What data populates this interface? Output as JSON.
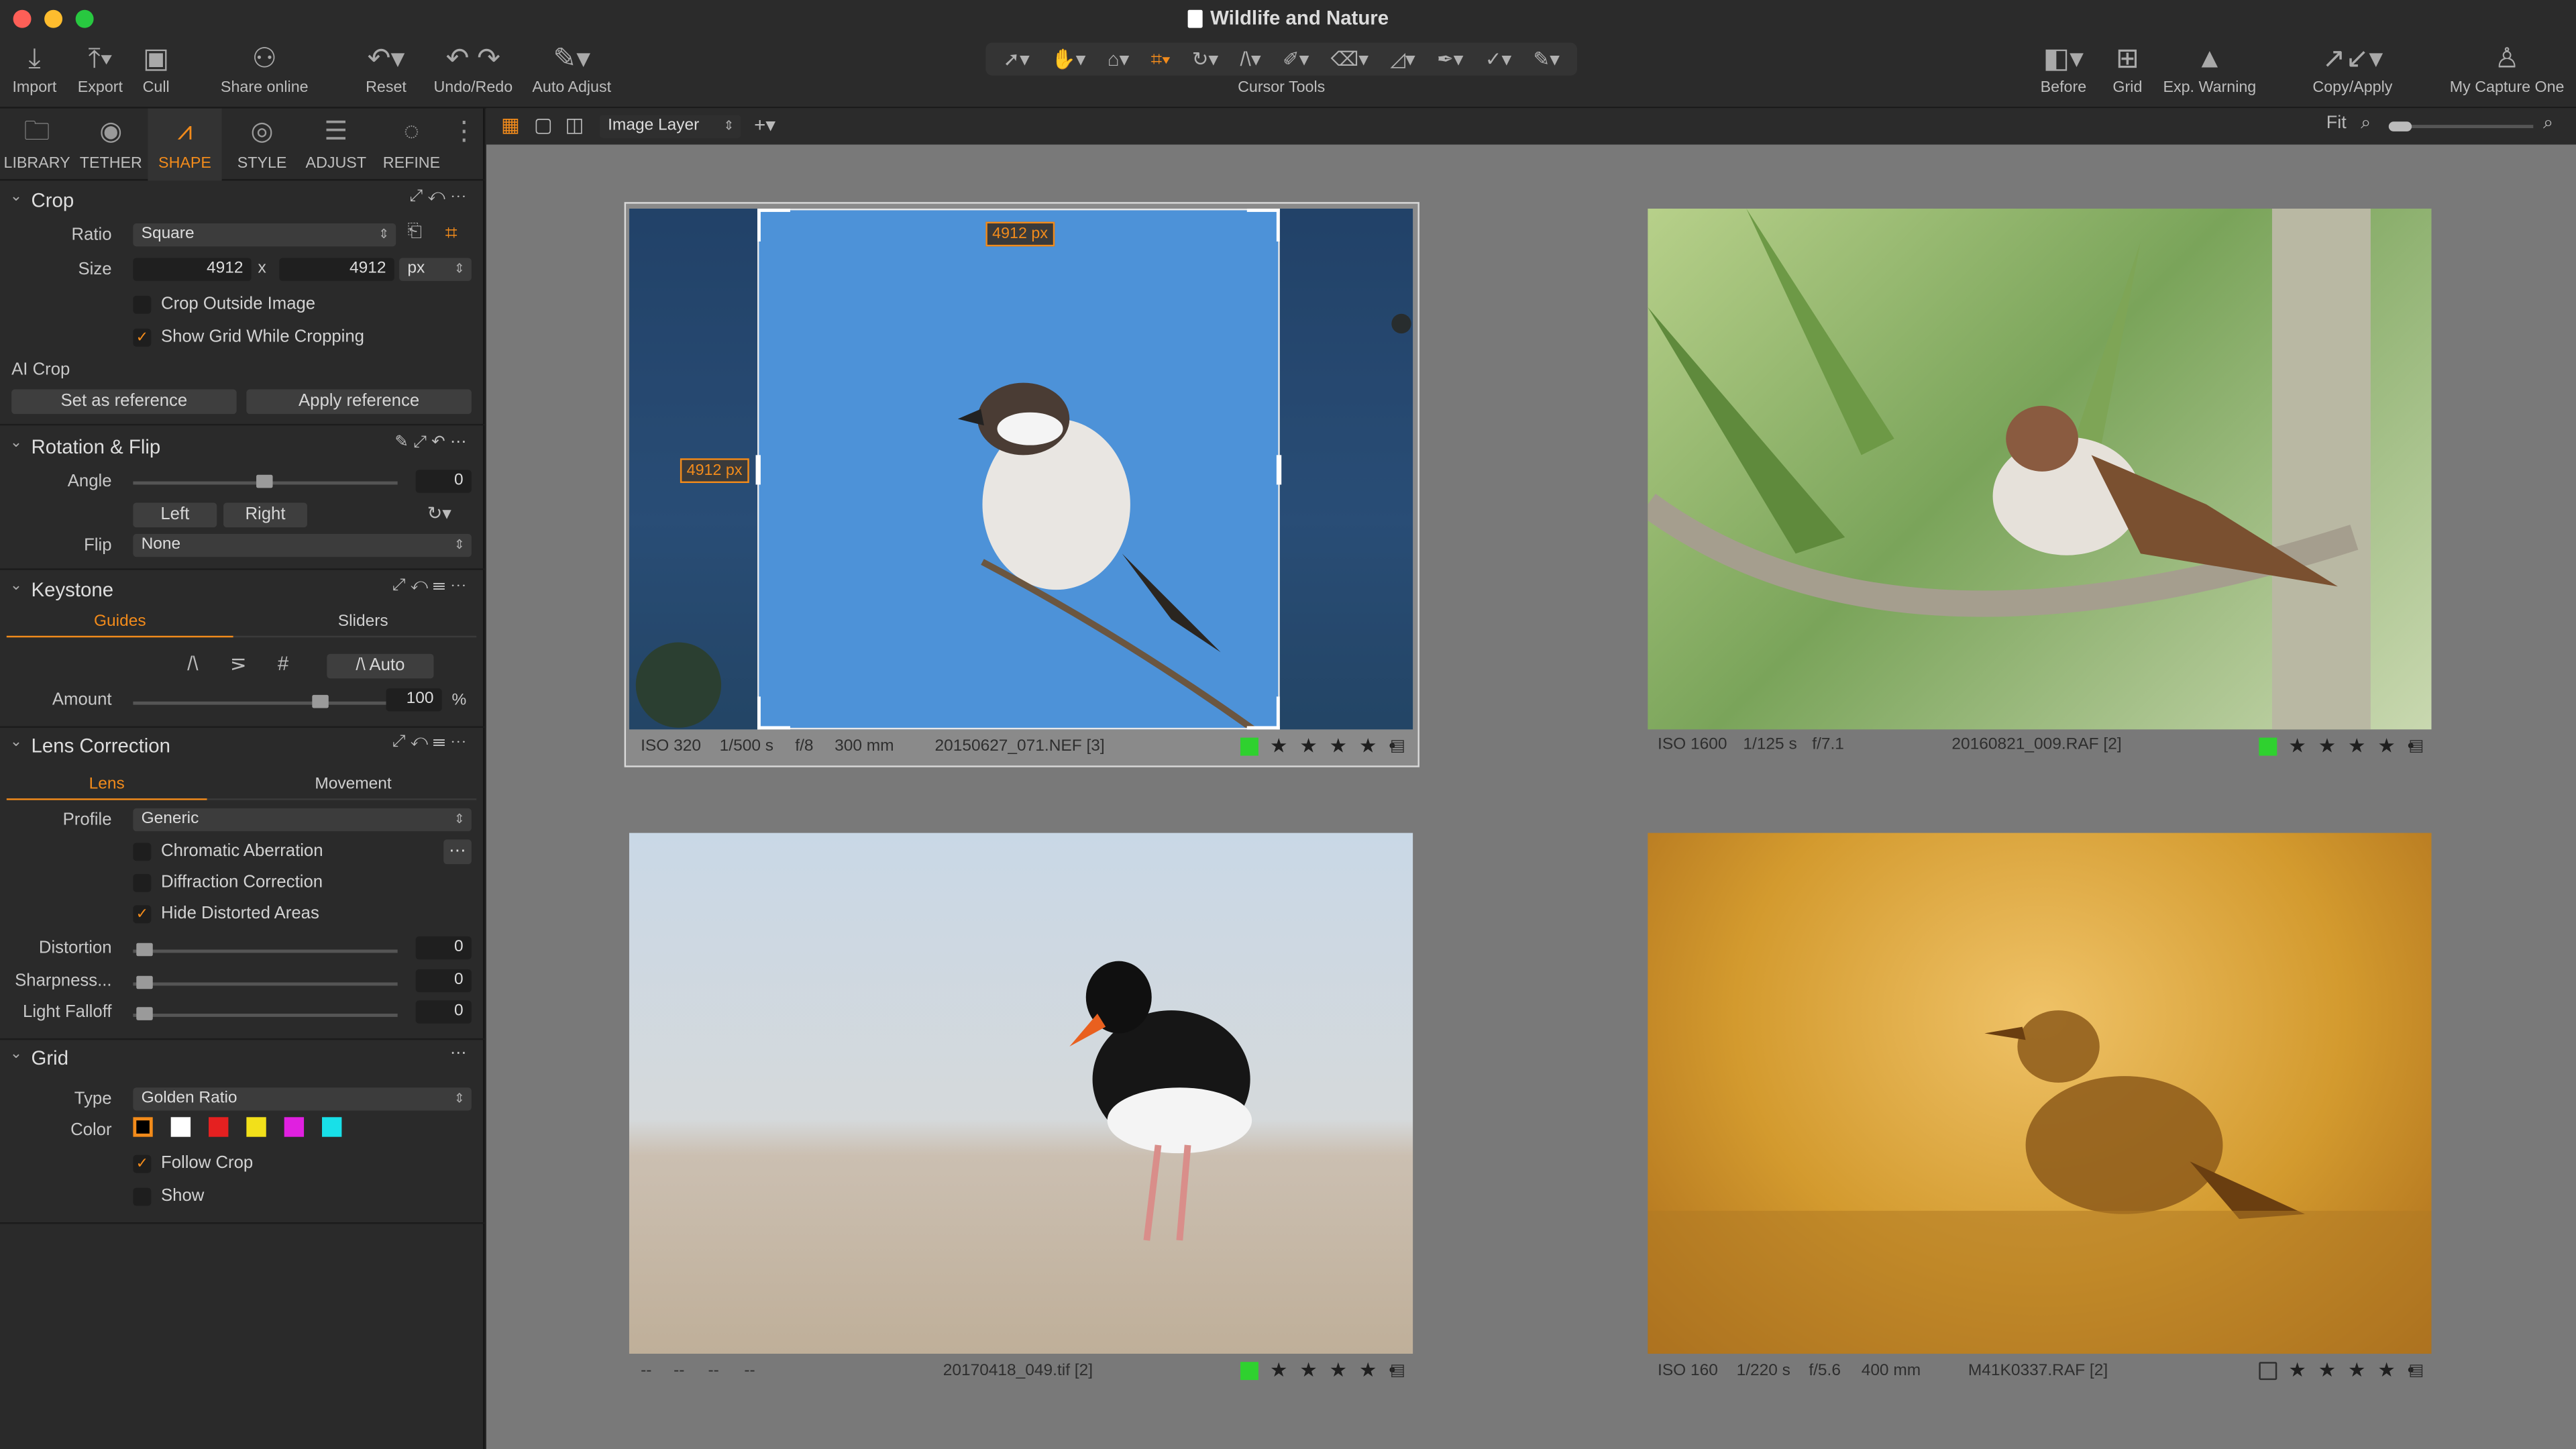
{
  "app": {
    "title": "Wildlife and Nature"
  },
  "toolbar": {
    "left": [
      {
        "label": "Import",
        "icon": "import-icon"
      },
      {
        "label": "Export",
        "icon": "export-icon"
      },
      {
        "label": "Cull",
        "icon": "cull-icon"
      },
      {
        "label": "Share online",
        "icon": "share-icon"
      },
      {
        "label": "Reset",
        "icon": "reset-icon"
      },
      {
        "label": "Undo/Redo",
        "icon": "undo-redo-icon"
      },
      {
        "label": "Auto Adjust",
        "icon": "auto-adjust-icon"
      }
    ],
    "cursor_tools_label": "Cursor Tools",
    "right": [
      {
        "label": "Before",
        "icon": "before-icon"
      },
      {
        "label": "Grid",
        "icon": "grid-icon"
      },
      {
        "label": "Exp. Warning",
        "icon": "warning-icon"
      },
      {
        "label": "Copy/Apply",
        "icon": "copy-apply-icon"
      },
      {
        "label": "My Capture One",
        "icon": "user-icon"
      }
    ]
  },
  "tool_tabs": [
    {
      "label": "LIBRARY",
      "icon": "folder-icon"
    },
    {
      "label": "TETHER",
      "icon": "camera-icon"
    },
    {
      "label": "SHAPE",
      "icon": "shape-icon",
      "active": true
    },
    {
      "label": "STYLE",
      "icon": "style-icon"
    },
    {
      "label": "ADJUST",
      "icon": "adjust-icon"
    },
    {
      "label": "REFINE",
      "icon": "refine-icon"
    }
  ],
  "crop": {
    "title": "Crop",
    "ratio_label": "Ratio",
    "ratio_value": "Square",
    "size_label": "Size",
    "width": "4912",
    "height": "4912",
    "x_sep": "x",
    "unit": "px",
    "crop_outside": "Crop Outside Image",
    "crop_outside_checked": false,
    "show_grid": "Show Grid While Cropping",
    "show_grid_checked": true,
    "ai_crop_label": "AI Crop",
    "set_reference": "Set as reference",
    "apply_reference": "Apply reference"
  },
  "rotation": {
    "title": "Rotation & Flip",
    "angle_label": "Angle",
    "angle_value": "0",
    "left_btn": "Left",
    "right_btn": "Right",
    "flip_label": "Flip",
    "flip_value": "None"
  },
  "keystone": {
    "title": "Keystone",
    "tab_guides": "Guides",
    "tab_sliders": "Sliders",
    "auto_btn": "Auto",
    "amount_label": "Amount",
    "amount_value": "100",
    "amount_unit": "%",
    "amount_fraction": 0.72
  },
  "lens": {
    "title": "Lens Correction",
    "tab_lens": "Lens",
    "tab_movement": "Movement",
    "profile_label": "Profile",
    "profile_value": "Generic",
    "chromatic": "Chromatic Aberration",
    "chromatic_checked": false,
    "diffraction": "Diffraction Correction",
    "diffraction_checked": false,
    "hide_distorted": "Hide Distorted Areas",
    "hide_distorted_checked": true,
    "distortion_label": "Distortion",
    "distortion_value": "0",
    "sharpness_label": "Sharpness...",
    "sharpness_value": "0",
    "falloff_label": "Light Falloff",
    "falloff_value": "0"
  },
  "grid": {
    "title": "Grid",
    "type_label": "Type",
    "type_value": "Golden Ratio",
    "color_label": "Color",
    "colors": [
      "#000000",
      "#ffffff",
      "#e52020",
      "#f2e01a",
      "#e020e0",
      "#18e0e8"
    ],
    "follow_crop": "Follow Crop",
    "follow_crop_checked": true,
    "show": "Show",
    "show_checked": false
  },
  "viewer": {
    "layer": "Image Layer",
    "fit": "Fit",
    "crop_px_top": "4912 px",
    "crop_px_left": "4912 px"
  },
  "images": [
    {
      "iso": "ISO 320",
      "shutter": "1/500 s",
      "aperture": "f/8",
      "focal": "300 mm",
      "file": "20150627_071.NEF [3]",
      "green": true,
      "stars": "★ ★ ★ ★ •"
    },
    {
      "iso": "ISO 1600",
      "shutter": "1/125 s",
      "aperture": "f/7.1",
      "focal": "",
      "file": "20160821_009.RAF [2]",
      "green": true,
      "stars": "★ ★ ★ ★ •"
    },
    {
      "iso": "--",
      "shutter": "--",
      "aperture": "--",
      "focal": "--",
      "file": "20170418_049.tif [2]",
      "green": true,
      "stars": "★ ★ ★ ★ •"
    },
    {
      "iso": "ISO 160",
      "shutter": "1/220 s",
      "aperture": "f/5.6",
      "focal": "400 mm",
      "file": "M41K0337.RAF [2]",
      "green": false,
      "stars": "★ ★ ★ ★ •"
    }
  ]
}
